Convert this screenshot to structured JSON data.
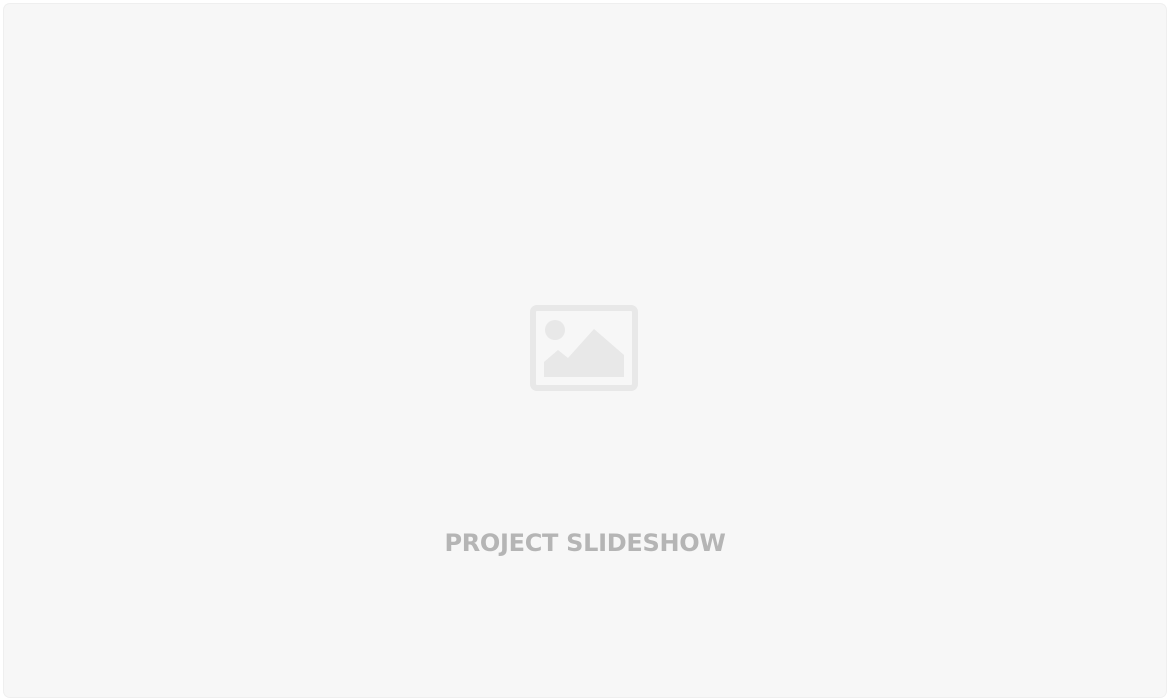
{
  "placeholder": {
    "icon": "image-placeholder-icon",
    "label": "PROJECT SLIDESHOW"
  },
  "colors": {
    "background": "#f7f7f7",
    "icon": "#e8e8e8",
    "label": "#b5b5b5"
  }
}
